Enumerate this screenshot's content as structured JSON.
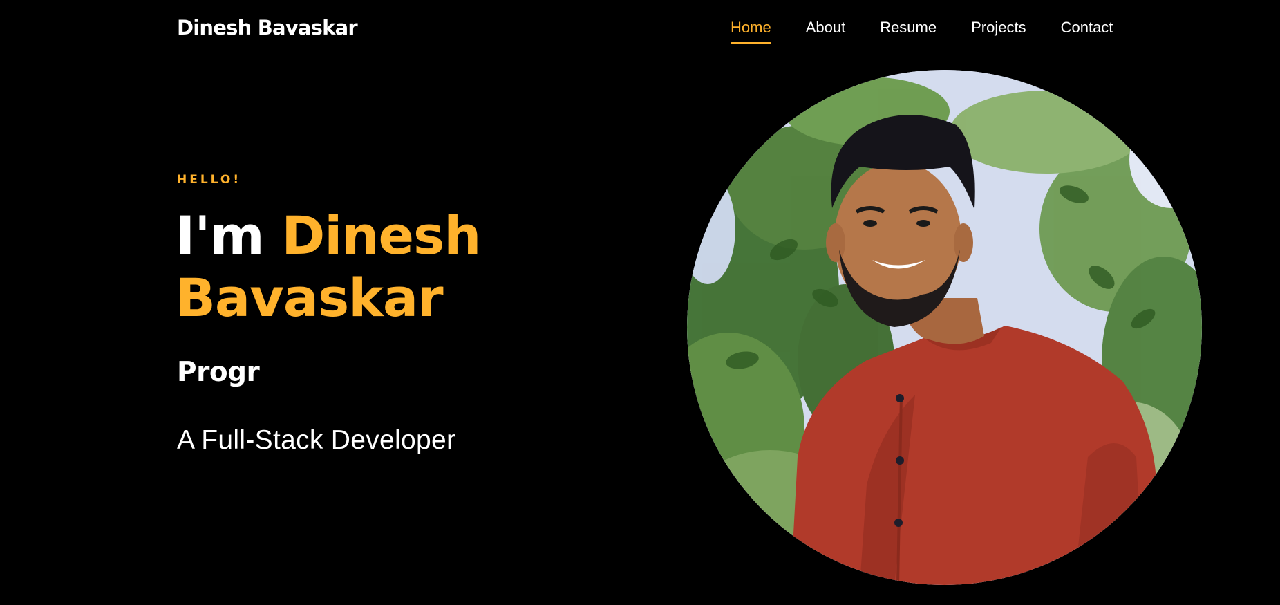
{
  "header": {
    "brand": "Dinesh Bavaskar",
    "nav": [
      {
        "label": "Home",
        "active": true
      },
      {
        "label": "About",
        "active": false
      },
      {
        "label": "Resume",
        "active": false
      },
      {
        "label": "Projects",
        "active": false
      },
      {
        "label": "Contact",
        "active": false
      }
    ]
  },
  "hero": {
    "greeting": "HELLO!",
    "headline_prefix": "I'm",
    "name_first": "Dinesh",
    "name_last": "Bavaskar",
    "typed_text": "Progr",
    "role": "A Full-Stack Developer"
  },
  "colors": {
    "background": "#000000",
    "accent": "#ffb22c",
    "text": "#ffffff"
  }
}
